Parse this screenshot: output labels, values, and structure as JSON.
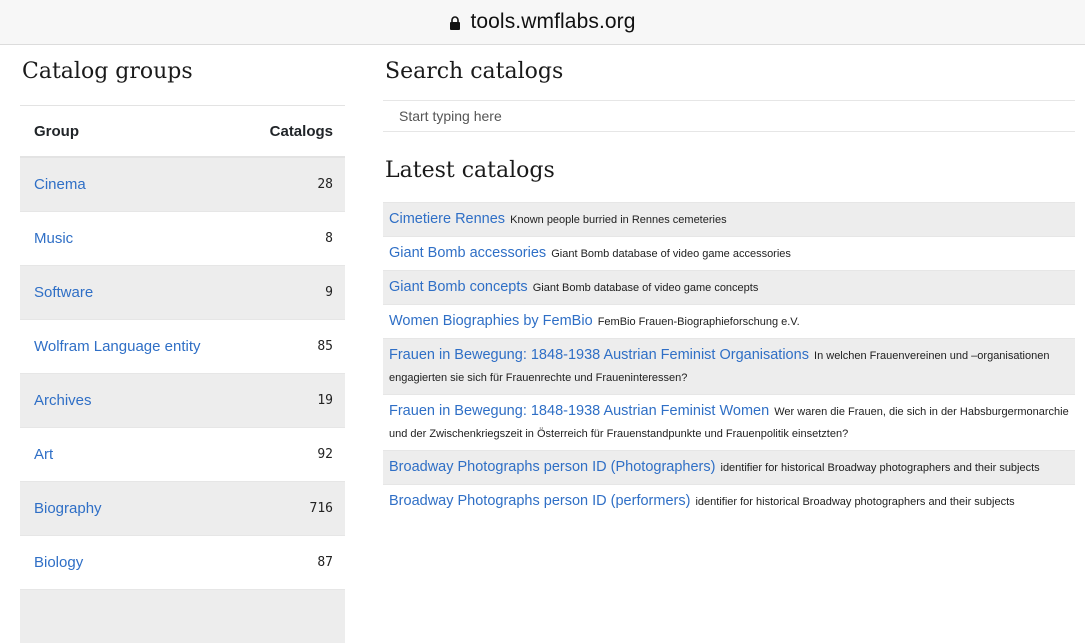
{
  "browser": {
    "url": "tools.wmflabs.org"
  },
  "groups": {
    "title": "Catalog groups",
    "col_group": "Group",
    "col_catalogs": "Catalogs",
    "rows": [
      {
        "name": "Cinema",
        "count": "28"
      },
      {
        "name": "Music",
        "count": "8"
      },
      {
        "name": "Software",
        "count": "9"
      },
      {
        "name": "Wolfram Language entity",
        "count": "85"
      },
      {
        "name": "Archives",
        "count": "19"
      },
      {
        "name": "Art",
        "count": "92"
      },
      {
        "name": "Biography",
        "count": "716"
      },
      {
        "name": "Biology",
        "count": "87"
      },
      {
        "name": "",
        "count": ""
      }
    ]
  },
  "search": {
    "title": "Search catalogs",
    "placeholder": "Start typing here"
  },
  "latest": {
    "title": "Latest catalogs",
    "items": [
      {
        "name": "Cimetiere Rennes",
        "desc": "Known people burried in Rennes cemeteries"
      },
      {
        "name": "Giant Bomb accessories",
        "desc": "Giant Bomb database of video game accessories"
      },
      {
        "name": "Giant Bomb concepts",
        "desc": "Giant Bomb database of video game concepts"
      },
      {
        "name": "Women Biographies by FemBio",
        "desc": "FemBio Frauen-Biographieforschung e.V."
      },
      {
        "name": "Frauen in Bewegung: 1848-1938 Austrian Feminist Organisations",
        "desc": "In welchen Frauenvereinen und –organisationen engagierten sie sich für Frauenrechte und Fraueninteressen?"
      },
      {
        "name": "Frauen in Bewegung: 1848-1938 Austrian Feminist Women",
        "desc": "Wer waren die Frauen, die sich in der Habsburgermonarchie und der Zwischenkriegszeit in Österreich für Frauenstandpunkte und Frauenpolitik einsetzten?"
      },
      {
        "name": "Broadway Photographs person ID (Photographers)",
        "desc": "identifier for historical Broadway photographers and their subjects"
      },
      {
        "name": "Broadway Photographs person ID (performers)",
        "desc": "identifier for historical Broadway photographers and their subjects"
      }
    ]
  }
}
